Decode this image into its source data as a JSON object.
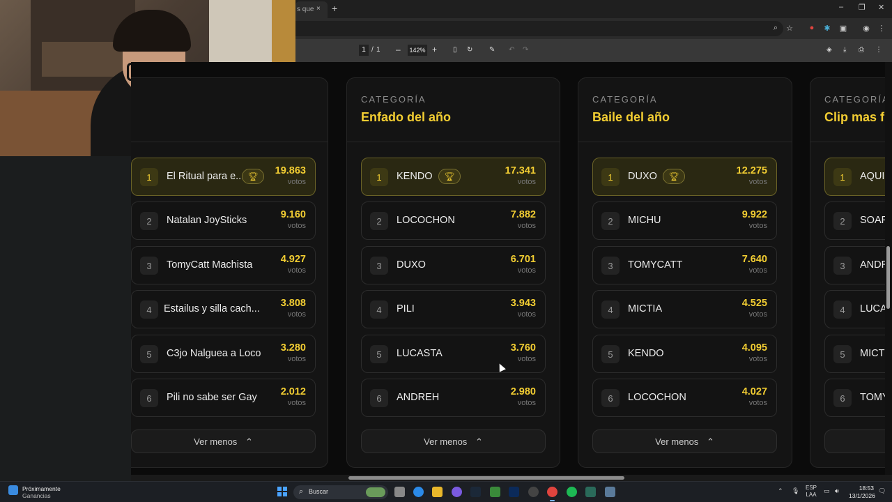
{
  "browser": {
    "tab_fragment": "s que",
    "tab_close": "×",
    "new_tab": "+",
    "window_controls": [
      "–",
      "❐",
      "✕"
    ],
    "pdf_toolbar": {
      "page_current": "1",
      "page_sep": "/",
      "page_total": "1",
      "zoom_out": "–",
      "zoom_level": "142%",
      "zoom_in": "+"
    }
  },
  "panels": [
    {
      "category_label": "",
      "category_title": "",
      "entries": [
        {
          "rank": "1",
          "name": "El Ritual para e...",
          "votes": "19.863",
          "votes_label": "votos",
          "winner": true
        },
        {
          "rank": "2",
          "name": "Natalan JoySticks",
          "votes": "9.160",
          "votes_label": "votos"
        },
        {
          "rank": "3",
          "name": "TomyCatt Machista",
          "votes": "4.927",
          "votes_label": "votos"
        },
        {
          "rank": "4",
          "name": "Estailus y silla cach...",
          "votes": "3.808",
          "votes_label": "votos"
        },
        {
          "rank": "5",
          "name": "C3jo Nalguea a Loco",
          "votes": "3.280",
          "votes_label": "votos"
        },
        {
          "rank": "6",
          "name": "Pili no sabe ser Gay",
          "votes": "2.012",
          "votes_label": "votos"
        }
      ],
      "toggle_label": "Ver menos"
    },
    {
      "category_label": "CATEGORÍA",
      "category_title": "Enfado del año",
      "entries": [
        {
          "rank": "1",
          "name": "KENDO",
          "votes": "17.341",
          "votes_label": "votos",
          "winner": true
        },
        {
          "rank": "2",
          "name": "LOCOCHON",
          "votes": "7.882",
          "votes_label": "votos"
        },
        {
          "rank": "3",
          "name": "DUXO",
          "votes": "6.701",
          "votes_label": "votos"
        },
        {
          "rank": "4",
          "name": "PILI",
          "votes": "3.943",
          "votes_label": "votos"
        },
        {
          "rank": "5",
          "name": "LUCASTA",
          "votes": "3.760",
          "votes_label": "votos"
        },
        {
          "rank": "6",
          "name": "ANDREH",
          "votes": "2.980",
          "votes_label": "votos"
        }
      ],
      "toggle_label": "Ver menos"
    },
    {
      "category_label": "CATEGORÍA",
      "category_title": "Baile del año",
      "entries": [
        {
          "rank": "1",
          "name": "DUXO",
          "votes": "12.275",
          "votes_label": "votos",
          "winner": true
        },
        {
          "rank": "2",
          "name": "MICHU",
          "votes": "9.922",
          "votes_label": "votos"
        },
        {
          "rank": "3",
          "name": "TOMYCATT",
          "votes": "7.640",
          "votes_label": "votos"
        },
        {
          "rank": "4",
          "name": "MICTIA",
          "votes": "4.525",
          "votes_label": "votos"
        },
        {
          "rank": "5",
          "name": "KENDO",
          "votes": "4.095",
          "votes_label": "votos"
        },
        {
          "rank": "6",
          "name": "LOCOCHON",
          "votes": "4.027",
          "votes_label": "votos"
        }
      ],
      "toggle_label": "Ver menos"
    },
    {
      "category_label": "CATEGORÍA",
      "category_title": "Clip mas f",
      "entries": [
        {
          "rank": "1",
          "name": "AQUI",
          "votes": "",
          "votes_label": "",
          "winner": true
        },
        {
          "rank": "2",
          "name": "SOAP",
          "votes": "",
          "votes_label": ""
        },
        {
          "rank": "3",
          "name": "ANDR",
          "votes": "",
          "votes_label": ""
        },
        {
          "rank": "4",
          "name": "LUCA",
          "votes": "",
          "votes_label": ""
        },
        {
          "rank": "5",
          "name": "MICT",
          "votes": "",
          "votes_label": ""
        },
        {
          "rank": "6",
          "name": "TOMY",
          "votes": "",
          "votes_label": ""
        }
      ],
      "toggle_label": ""
    }
  ],
  "taskbar": {
    "weather_title": "Próximamente",
    "weather_subtitle": "Ganancias",
    "search_placeholder": "Buscar",
    "lang_top": "ESP",
    "lang_bottom": "LAA",
    "time": "18:53",
    "date": "13/1/2026"
  },
  "colors": {
    "accent": "#f2cd32",
    "panel_bg": "#141414",
    "winner_bg": "#2a2812"
  }
}
